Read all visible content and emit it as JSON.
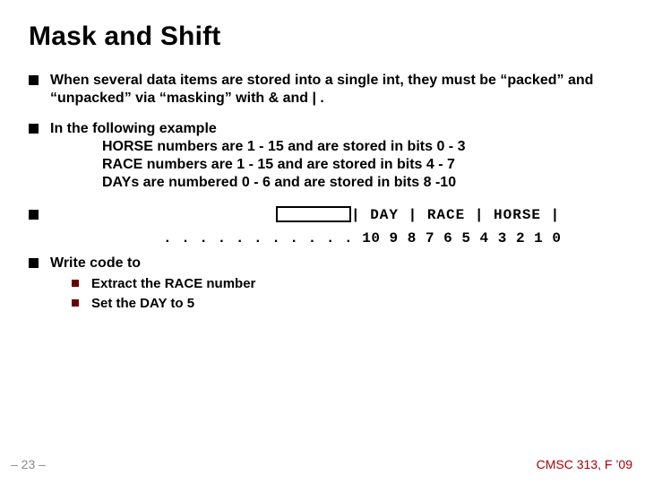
{
  "title": "Mask and Shift",
  "bullets": {
    "b1": "When several data items are stored into a single int, they must be “packed” and “unpacked” via “masking” with & and | .",
    "b2_intro": "In the following example",
    "b2_line1": "HORSE numbers are 1 - 15 and are stored in bits 0 - 3",
    "b2_line2": "RACE numbers are 1 - 15 and are stored in bits 4 - 7",
    "b2_line3": "DAYs are numbered 0 - 6 and are stored in bits 8 -10",
    "b3": "Write code to",
    "b3_sub1": "Extract the RACE number",
    "b3_sub2": "Set the DAY to 5"
  },
  "bits": {
    "header": "| DAY  | RACE   |  HORSE |",
    "row": ". . . . . . . . . . . 10 9 8 7 6 5 4 3 2 1 0"
  },
  "footer": {
    "left": "– 23 –",
    "right": "CMSC 313, F ’09"
  }
}
